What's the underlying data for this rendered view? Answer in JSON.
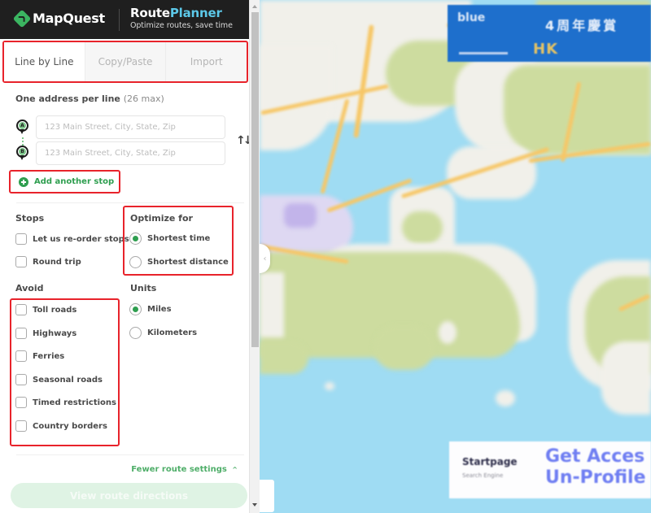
{
  "header": {
    "brand": "MapQuest",
    "product_title_part1": "Route",
    "product_title_part2": "Planner",
    "tagline": "Optimize routes, save time"
  },
  "tabs": [
    {
      "label": "Line by Line",
      "active": true
    },
    {
      "label": "Copy/Paste",
      "active": false
    },
    {
      "label": "Import",
      "active": false
    }
  ],
  "addresses": {
    "heading": "One address per line",
    "limit_note": "(26 max)",
    "stops": [
      {
        "marker": "A",
        "value": "",
        "placeholder": "123 Main Street, City, State, Zip"
      },
      {
        "marker": "B",
        "value": "",
        "placeholder": "123 Main Street, City, State, Zip"
      }
    ],
    "swap_icon": "swap-vertical-icon",
    "add_stop_label": "Add another stop"
  },
  "stops_options": {
    "heading": "Stops",
    "items": [
      {
        "label": "Let us re-order stops",
        "checked": false
      },
      {
        "label": "Round trip",
        "checked": false
      }
    ]
  },
  "optimize": {
    "heading": "Optimize for",
    "options": [
      {
        "label": "Shortest time",
        "selected": true
      },
      {
        "label": "Shortest distance",
        "selected": false
      }
    ]
  },
  "avoid": {
    "heading": "Avoid",
    "items": [
      {
        "label": "Toll roads",
        "checked": false
      },
      {
        "label": "Highways",
        "checked": false
      },
      {
        "label": "Ferries",
        "checked": false
      },
      {
        "label": "Seasonal roads",
        "checked": false
      },
      {
        "label": "Timed restrictions",
        "checked": false
      },
      {
        "label": "Country borders",
        "checked": false
      }
    ]
  },
  "units": {
    "heading": "Units",
    "options": [
      {
        "label": "Miles",
        "selected": true
      },
      {
        "label": "Kilometers",
        "selected": false
      }
    ]
  },
  "footer": {
    "fewer_settings_label": "Fewer route settings",
    "fewer_settings_icon": "chevron-up-icon",
    "view_directions_label": "View route directions"
  },
  "colors": {
    "accent_green": "#2e9e4f",
    "highlight_red": "#e8232b",
    "header_bg": "#1f1f1f",
    "planner_blue": "#5cc8e8"
  },
  "map": {
    "ad_top": {
      "line1": "blue",
      "line2": "4周年慶賞",
      "line3": "HK"
    },
    "ad_bottom": {
      "brand": "Startpage",
      "brand_sub": "Search Engine",
      "cta_line1": "Get Acces",
      "cta_line2": "Un-Profile"
    }
  }
}
